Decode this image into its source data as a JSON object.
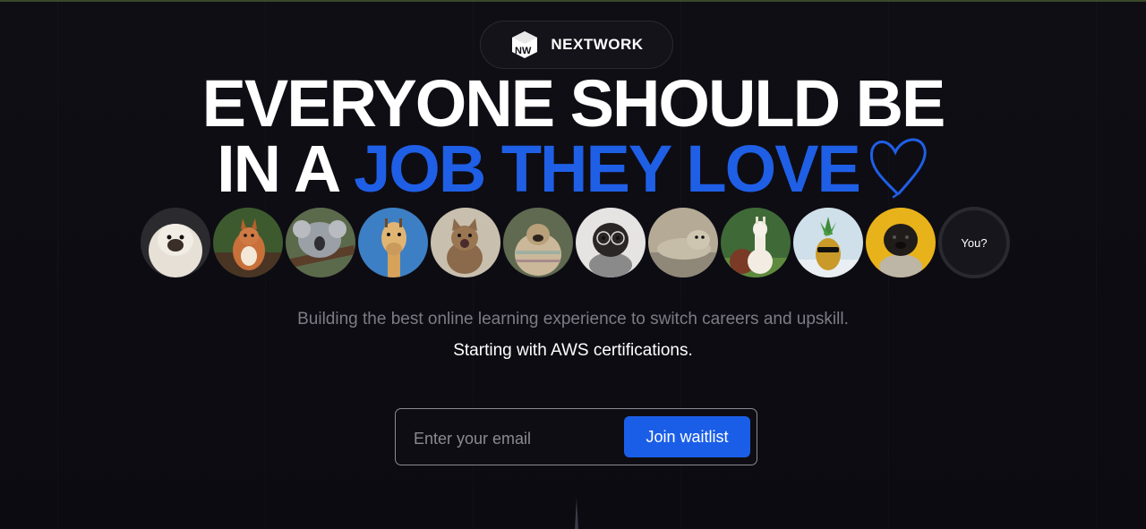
{
  "brand": {
    "name": "NEXTWORK",
    "logo_text": "NW"
  },
  "headline": {
    "line1": "EVERYONE SHOULD BE",
    "line2_prefix": "IN A ",
    "line2_accent": "JOB THEY LOVE"
  },
  "avatars": {
    "items": [
      {
        "name": "fluffy-dog-avatar"
      },
      {
        "name": "squirrel-avatar"
      },
      {
        "name": "koala-avatar"
      },
      {
        "name": "giraffe-avatar"
      },
      {
        "name": "cat-avatar"
      },
      {
        "name": "pug-blanket-avatar"
      },
      {
        "name": "pug-glasses-avatar"
      },
      {
        "name": "seal-avatar"
      },
      {
        "name": "alpaca-avatar"
      },
      {
        "name": "pineapple-avatar"
      },
      {
        "name": "pug-yellow-avatar"
      }
    ],
    "you_label": "You?"
  },
  "subtitle": "Building the best online learning experience to switch careers and upskill.",
  "subtitle2": "Starting with AWS certifications.",
  "form": {
    "email_placeholder": "Enter your email",
    "email_value": "",
    "button_label": "Join waitlist"
  },
  "colors": {
    "accent": "#1f5fe6",
    "button": "#1a5ee8",
    "background": "#0d0c12"
  }
}
